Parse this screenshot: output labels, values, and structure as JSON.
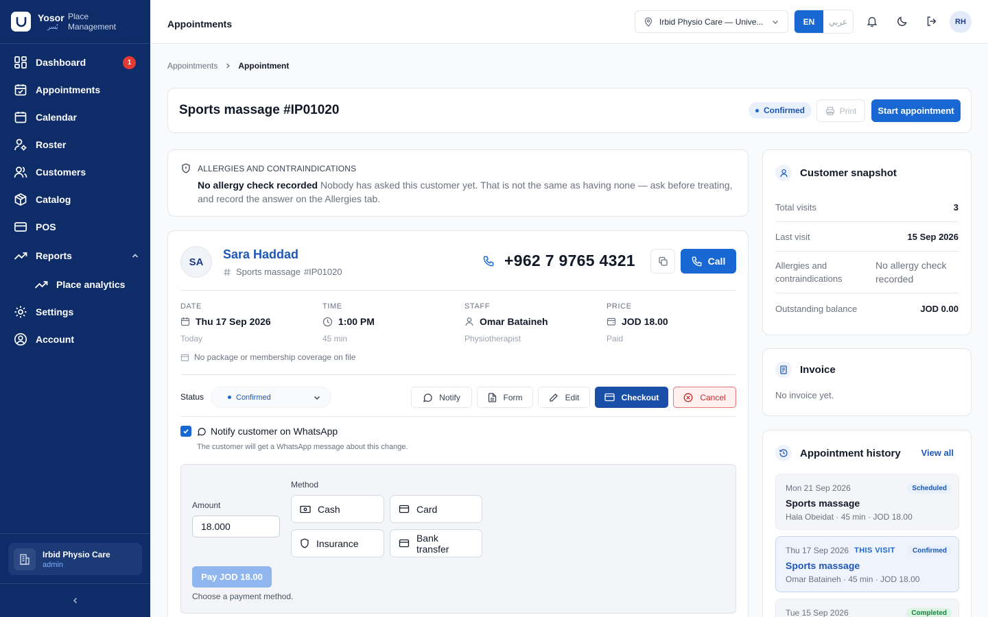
{
  "brand": {
    "name": "Yosor",
    "arabic": "يُسر",
    "subtitle": "Place Management"
  },
  "sidebar": {
    "items": [
      {
        "label": "Dashboard",
        "icon": "dashboard-icon",
        "badge": "1"
      },
      {
        "label": "Appointments",
        "icon": "calendar-check-icon"
      },
      {
        "label": "Calendar",
        "icon": "calendar-icon"
      },
      {
        "label": "Roster",
        "icon": "user-cog-icon"
      },
      {
        "label": "Customers",
        "icon": "users-icon"
      },
      {
        "label": "Catalog",
        "icon": "box-icon"
      },
      {
        "label": "POS",
        "icon": "credit-card-icon"
      },
      {
        "label": "Reports",
        "icon": "trending-up-icon"
      },
      {
        "label": "Place analytics",
        "icon": "trending-up-icon"
      },
      {
        "label": "Settings",
        "icon": "gear-icon"
      },
      {
        "label": "Account",
        "icon": "user-circle-icon"
      }
    ],
    "place": {
      "name": "Irbid Physio Care",
      "role": "admin"
    }
  },
  "header": {
    "title": "Appointments",
    "place_select": "Irbid Physio Care — Unive...",
    "lang_en": "EN",
    "lang_ar": "عربي",
    "avatar": "RH"
  },
  "breadcrumb": {
    "parent": "Appointments",
    "current": "Appointment"
  },
  "appointment": {
    "title": "Sports massage #IP01020",
    "status": "Confirmed",
    "print_label": "Print",
    "start_label": "Start appointment"
  },
  "allergy": {
    "heading": "ALLERGIES AND CONTRAINDICATIONS",
    "strong": "No allergy check recorded",
    "text": "Nobody has asked this customer yet. That is not the same as having none — ask before treating, and record the answer on the Allergies tab."
  },
  "customer": {
    "initials": "SA",
    "name": "Sara Haddad",
    "service": "Sports massage",
    "ref": "#IP01020",
    "phone": "+962 7 9765 4321",
    "call_label": "Call"
  },
  "details": {
    "date": {
      "label": "DATE",
      "value": "Thu 17 Sep 2026",
      "sub": "Today"
    },
    "time": {
      "label": "TIME",
      "value": "1:00 PM",
      "sub": "45 min"
    },
    "staff": {
      "label": "STAFF",
      "value": "Omar Bataineh",
      "sub": "Physiotherapist"
    },
    "price": {
      "label": "PRICE",
      "value": "JOD 18.00",
      "sub": "Paid"
    },
    "package_note": "No package or membership coverage on file"
  },
  "status_bar": {
    "label": "Status",
    "selected": "Confirmed",
    "notify": "Notify",
    "form": "Form",
    "edit": "Edit",
    "checkout": "Checkout",
    "cancel": "Cancel"
  },
  "whatsapp": {
    "label": "Notify customer on WhatsApp",
    "sub": "The customer will get a WhatsApp message about this change."
  },
  "payment": {
    "method_label": "Method",
    "amount_label": "Amount",
    "amount_value": "18.000",
    "methods": [
      "Cash",
      "Card",
      "Insurance",
      "Bank transfer"
    ],
    "pay_label": "Pay  JOD 18.00",
    "hint": "Choose a payment method."
  },
  "snapshot": {
    "title": "Customer snapshot",
    "rows": [
      {
        "k": "Total visits",
        "v": "3"
      },
      {
        "k": "Last visit",
        "v": "15 Sep 2026"
      },
      {
        "k": "Allergies and contraindications",
        "v": "No allergy check recorded"
      },
      {
        "k": "Outstanding balance",
        "v": "JOD 0.00"
      }
    ]
  },
  "invoice": {
    "title": "Invoice",
    "text": "No invoice yet."
  },
  "history": {
    "title": "Appointment history",
    "view_all": "View all",
    "items": [
      {
        "date": "Mon 21 Sep 2026",
        "badge": "Scheduled",
        "title": "Sports massage",
        "meta": "Hala Obeidat · 45 min · JOD 18.00"
      },
      {
        "date": "Thu 17 Sep 2026",
        "this": "THIS VISIT",
        "badge": "Confirmed",
        "title": "Sports massage",
        "meta": "Omar Bataineh · 45 min · JOD 18.00"
      },
      {
        "date": "Tue 15 Sep 2026",
        "badge": "Completed"
      }
    ]
  },
  "colors": {
    "sidebar": "#0e2d68",
    "primary": "#1967d2",
    "danger": "#e53935"
  }
}
